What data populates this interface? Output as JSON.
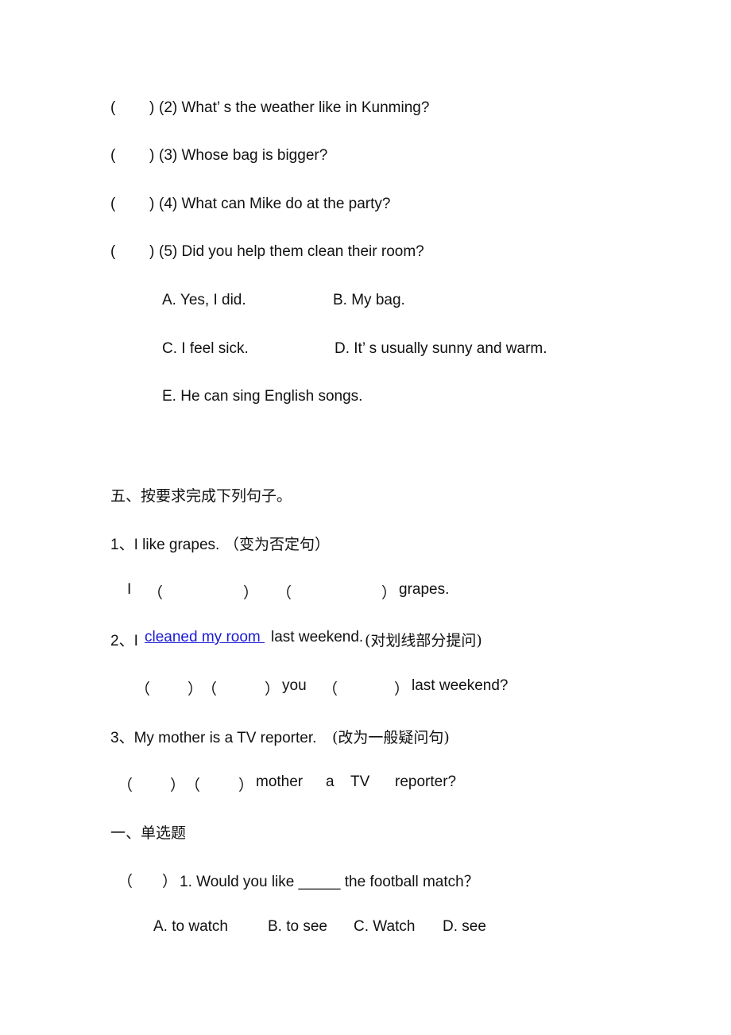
{
  "matching": {
    "questions": [
      {
        "open": "(",
        "close": ")",
        "text": "(2) What’ s the weather like in Kunming?"
      },
      {
        "open": "(",
        "close": ")",
        "text": "(3) Whose bag is bigger?"
      },
      {
        "open": "(",
        "close": ")",
        "text": "(4) What can Mike do at the party?"
      },
      {
        "open": "(",
        "close": ")",
        "text": "(5) Did you help them clean their room?"
      }
    ],
    "options": [
      {
        "text": "A. Yes, I did."
      },
      {
        "text": "B. My bag."
      },
      {
        "text": "C. I feel sick."
      },
      {
        "text": "D. It’ s usually sunny and warm."
      },
      {
        "text": "E. He can sing English songs."
      }
    ]
  },
  "section5": {
    "heading": "五、按要求完成下列句子。",
    "items": [
      {
        "prompt": "1、I like grapes.",
        "instruction": "（变为否定句）",
        "answer": {
          "w1": "I",
          "p1o": "（",
          "p1c": "）",
          "p2o": "（",
          "p2c": "）",
          "tail": "grapes."
        }
      },
      {
        "prompt_pre": "2、I ",
        "prompt_link": "cleaned my room ",
        "prompt_post": "last weekend.",
        "instruction": "(对划线部分提问)",
        "answer": {
          "p1o": "（",
          "p1c": "）",
          "p2o": "（",
          "p2c": "）",
          "w1": "you",
          "p3o": "（",
          "p3c": "）",
          "tail": "last weekend?"
        }
      },
      {
        "prompt": "3、My mother is a TV reporter.",
        "instruction": "(改为一般疑问句)",
        "answer": {
          "p1o": "（",
          "p1c": "）",
          "p2o": "（",
          "p2c": "）",
          "w1": "mother",
          "w2": "a",
          "w3": "TV",
          "w4": "reporter?"
        }
      }
    ]
  },
  "section1": {
    "heading": "一、单选题",
    "question": {
      "open": "（",
      "close": "）",
      "text": "1. Would you like _____ the football match？"
    },
    "options": [
      "A. to watch",
      "B. to see",
      "C. Watch",
      "D. see"
    ]
  }
}
